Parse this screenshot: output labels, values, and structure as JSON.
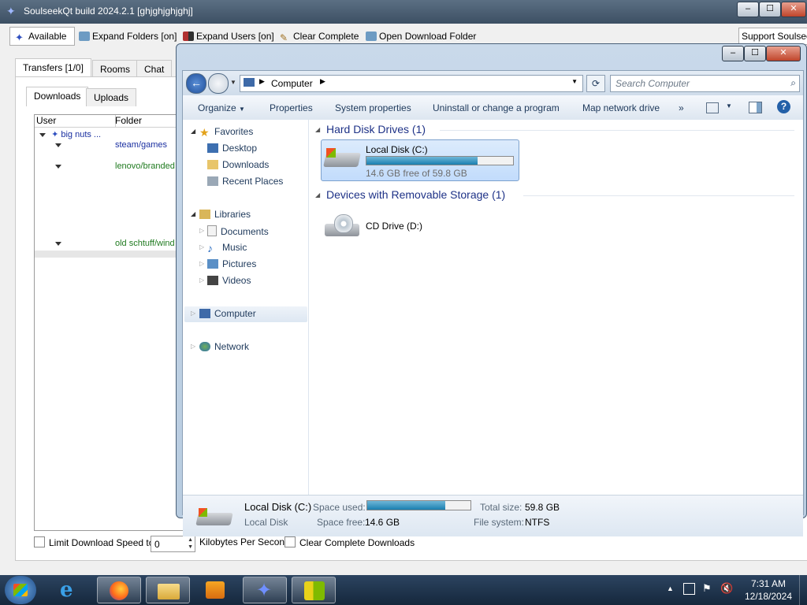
{
  "slsk": {
    "title": "SoulseekQt build 2024.2.1 [ghjghjghjghj]",
    "window_controls": [
      "–",
      "☐",
      "✕"
    ],
    "toolbar": {
      "available": "Available",
      "expand_folders": "Expand Folders [on]",
      "expand_users": "Expand Users [on]",
      "clear_complete": "Clear Complete",
      "open_download_folder": "Open Download Folder",
      "support": "Support Soulseek"
    },
    "main_tabs": [
      "Transfers [1/0]",
      "Rooms",
      "Chat"
    ],
    "sub_tabs": [
      "Downloads",
      "Uploads"
    ],
    "columns": {
      "user": "User",
      "folder": "Folder"
    },
    "rows": [
      {
        "user": "big nuts ...",
        "folder": ""
      },
      {
        "user": "",
        "folder": "steam/games"
      },
      {
        "user": "",
        "folder": "lenovo/branded"
      },
      {
        "user": "",
        "folder": "old schtuff/wind"
      }
    ],
    "bottom": {
      "limit_label": "Limit Download Speed to",
      "speed_value": "0",
      "units": "Kilobytes Per Second",
      "clear_label": "Clear Complete Downloads"
    }
  },
  "explorer": {
    "window_controls": [
      "–",
      "☐",
      "✕"
    ],
    "address": "Computer",
    "search_placeholder": "Search Computer",
    "commands": [
      "Organize",
      "Properties",
      "System properties",
      "Uninstall or change a program",
      "Map network drive",
      "»"
    ],
    "nav": {
      "favorites": "Favorites",
      "desktop": "Desktop",
      "downloads": "Downloads",
      "recent": "Recent Places",
      "libraries": "Libraries",
      "documents": "Documents",
      "music": "Music",
      "pictures": "Pictures",
      "videos": "Videos",
      "computer": "Computer",
      "network": "Network"
    },
    "groups": {
      "hdd": "Hard Disk Drives (1)",
      "removable": "Devices with Removable Storage (1)"
    },
    "drive_c": {
      "name": "Local Disk (C:)",
      "free_text": "14.6 GB free of 59.8 GB",
      "used_fraction": 0.756
    },
    "drive_d": {
      "name": "CD Drive (D:)"
    },
    "details": {
      "name": "Local Disk (C:)",
      "type": "Local Disk",
      "space_used_label": "Space used:",
      "space_free_label": "Space free:",
      "space_free": "14.6 GB",
      "total_size_label": "Total size:",
      "total_size": "59.8 GB",
      "fs_label": "File system:",
      "fs": "NTFS"
    }
  },
  "taskbar": {
    "time": "7:31 AM",
    "date": "12/18/2024"
  }
}
